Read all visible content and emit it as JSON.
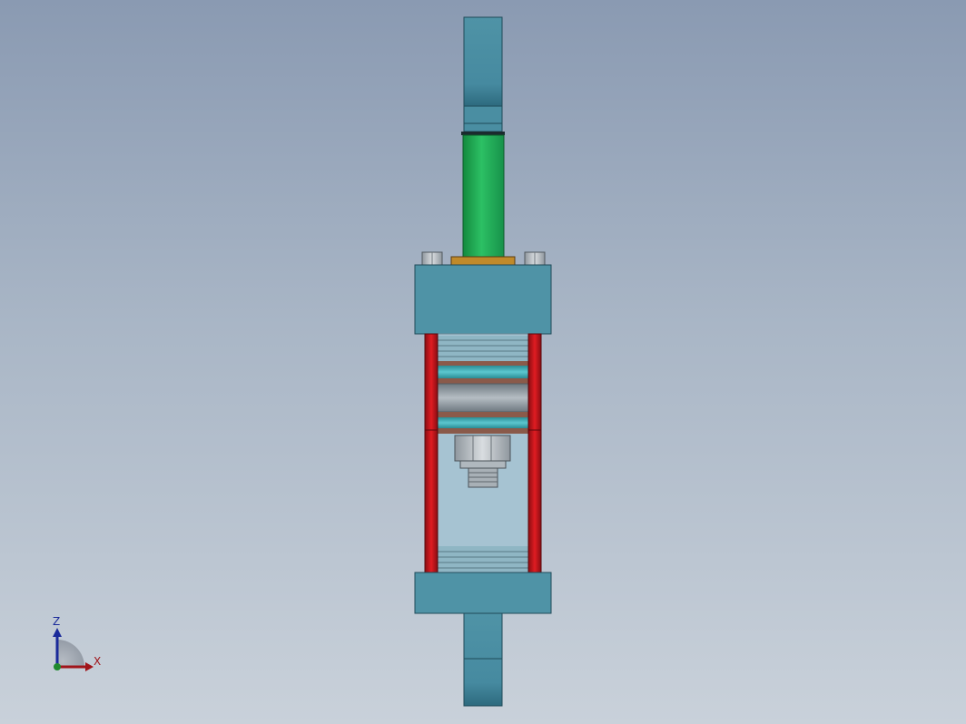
{
  "viewport": {
    "background_top": "#8a9ab2",
    "background_bottom": "#c9d1da"
  },
  "model": {
    "name": "",
    "colors": {
      "clevis": "#4f93a6",
      "end_cap": "#4f93a6",
      "piston_rod": "#27a858",
      "tie_rod": "#c8141a",
      "rod_seal": "#c08a2a",
      "bolt": "#b8bec4",
      "barrel_glass": "#a6c3d2",
      "piston_band": "#3fb0b8",
      "piston_body": "#9aa4ac"
    }
  },
  "triad": {
    "z_label": "Z",
    "x_label": "X",
    "z_color": "#1a2a9a",
    "x_color": "#a0141a",
    "y_color": "#1f8a2e"
  }
}
